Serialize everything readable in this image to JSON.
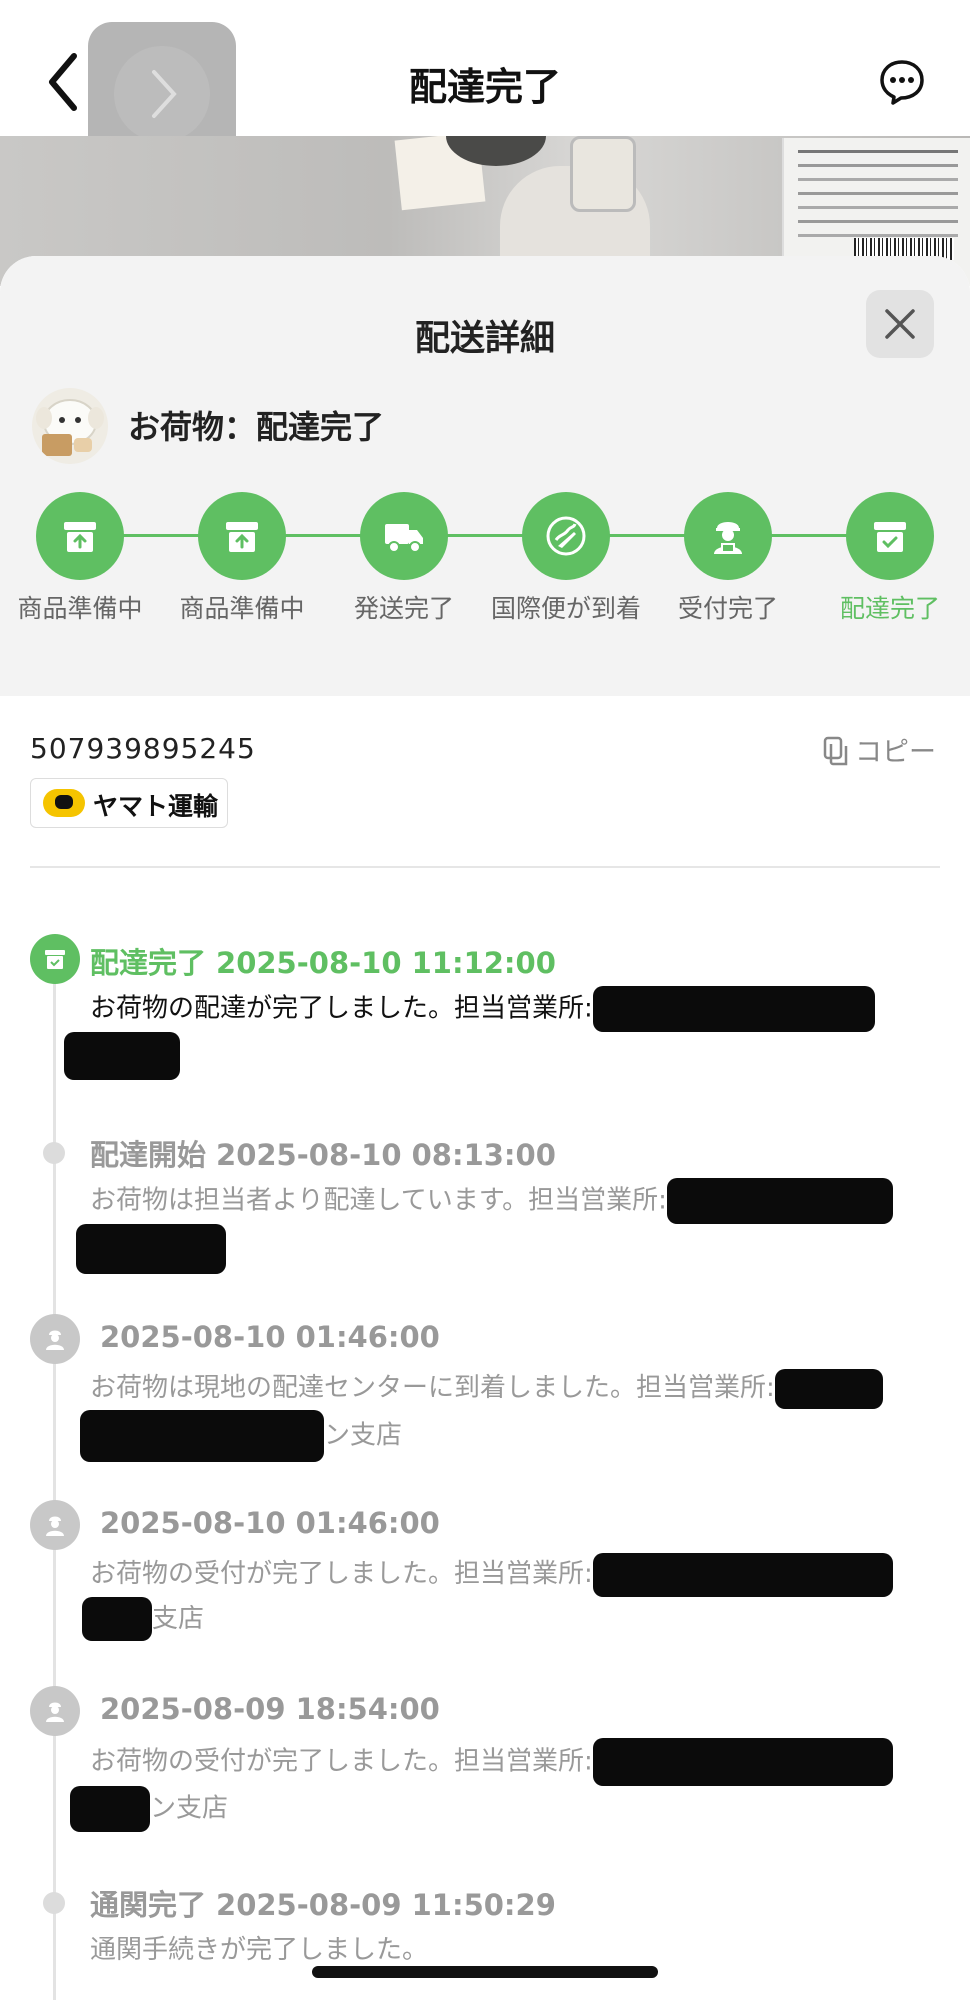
{
  "nav": {
    "title": "配達完了"
  },
  "sheet": {
    "title": "配送詳細",
    "status_title": "お荷物：配達完了"
  },
  "steps": [
    {
      "label": "商品準備中",
      "icon": "box-up-icon"
    },
    {
      "label": "商品準備中",
      "icon": "box-up-icon"
    },
    {
      "label": "発送完了",
      "icon": "truck-icon"
    },
    {
      "label": "国際便が到着",
      "icon": "globe-plane-icon"
    },
    {
      "label": "受付完了",
      "icon": "courier-icon"
    },
    {
      "label": "配達完了",
      "icon": "box-check-icon"
    }
  ],
  "tracking": {
    "number": "507939895245",
    "copy_label": "コピー",
    "carrier": "ヤマト運輸"
  },
  "events": [
    {
      "status": "配達完了",
      "time": "2025-08-10 11:12:00",
      "desc": "お荷物の配達が完了しました。担当営業所:",
      "tail": ""
    },
    {
      "status": "配達開始",
      "time": "2025-08-10 08:13:00",
      "desc": "お荷物は担当者より配達しています。担当営業所:",
      "tail": ""
    },
    {
      "status": "",
      "time": "2025-08-10 01:46:00",
      "desc": "お荷物は現地の配達センターに到着しました。担当営業所:",
      "tail": "ン支店"
    },
    {
      "status": "",
      "time": "2025-08-10 01:46:00",
      "desc": "お荷物の受付が完了しました。担当営業所:",
      "tail": "支店"
    },
    {
      "status": "",
      "time": "2025-08-09 18:54:00",
      "desc": "お荷物の受付が完了しました。担当営業所:",
      "tail": "ン支店"
    },
    {
      "status": "通関完了",
      "time": "2025-08-09 11:50:29",
      "desc": "通関手続きが完了しました。",
      "tail": ""
    }
  ],
  "colors": {
    "accent_green": "#5fbf62",
    "muted_text": "#999999",
    "sheet_header_bg": "#f3f3f3"
  }
}
